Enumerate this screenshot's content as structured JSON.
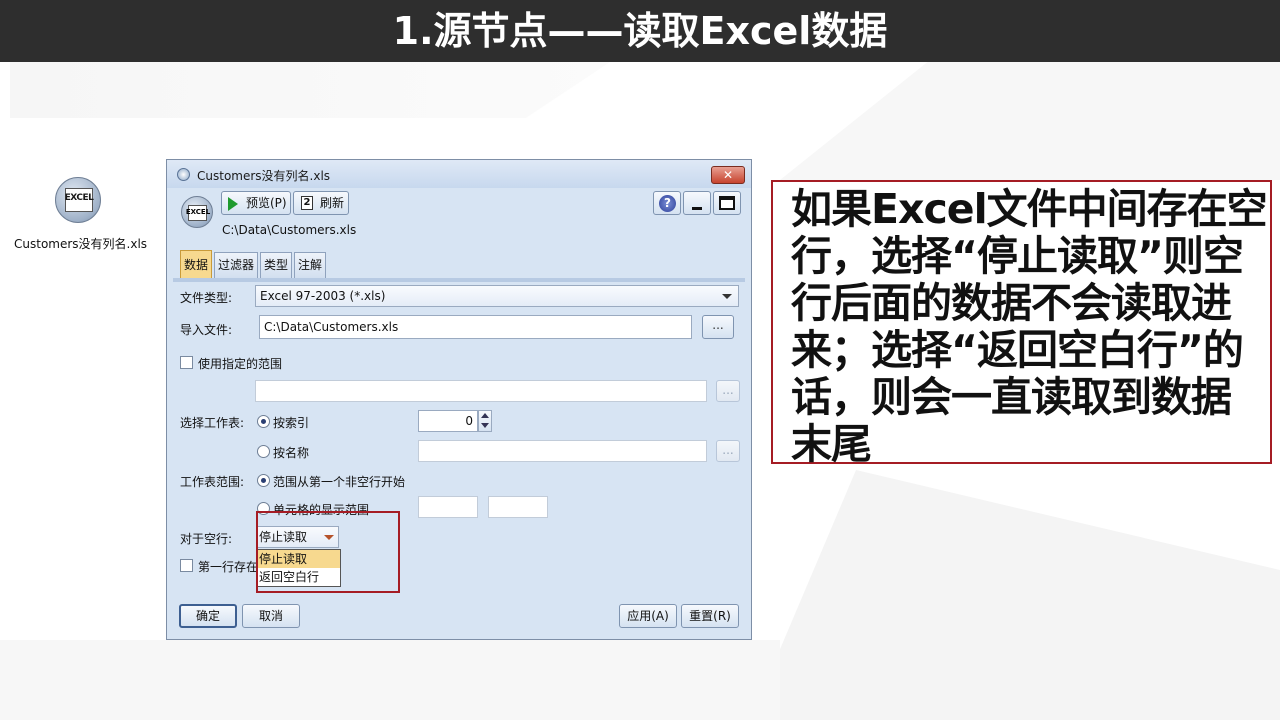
{
  "page": {
    "title": "1.源节点——读取Excel数据"
  },
  "node": {
    "icon": "excel-node-icon",
    "icon_text": "EXCEL",
    "label": "Customers没有列名.xls"
  },
  "dialog": {
    "title": "Customers没有列名.xls",
    "close_label": "✕",
    "toolbar": {
      "preview_label": "预览(P)",
      "refresh_label": "刷新",
      "refresh_icon_text": "2"
    },
    "help_label": "?",
    "file_path": "C:\\Data\\Customers.xls",
    "tabs": [
      {
        "label": "数据",
        "active": true
      },
      {
        "label": "过滤器",
        "active": false
      },
      {
        "label": "类型",
        "active": false
      },
      {
        "label": "注解",
        "active": false
      }
    ],
    "form": {
      "file_type_label": "文件类型:",
      "file_type_value": "Excel 97-2003 (*.xls)",
      "import_file_label": "导入文件:",
      "import_file_value": "C:\\Data\\Customers.xls",
      "browse_label": "...",
      "use_range_label": "使用指定的范围",
      "use_range_checked": false,
      "use_range_value": "",
      "select_sheet_label": "选择工作表:",
      "by_index_label": "按索引",
      "by_index_selected": true,
      "index_value": "0",
      "by_name_label": "按名称",
      "by_name_selected": false,
      "sheet_name_value": "",
      "sheet_range_label": "工作表范围:",
      "range_first_nonblank_label": "范围从第一个非空行开始",
      "range_first_nonblank_selected": true,
      "cell_range_label": "单元格的显示范围",
      "cell_range_selected": false,
      "cell_from": "",
      "cell_to": "",
      "blank_rows_label": "对于空行:",
      "blank_rows_value": "停止读取",
      "blank_rows_options": [
        "停止读取",
        "返回空白行"
      ],
      "first_row_label": "第一行存在",
      "first_row_checked": false
    },
    "buttons": {
      "ok": "确定",
      "cancel": "取消",
      "apply": "应用(A)",
      "reset": "重置(R)"
    }
  },
  "callout": {
    "text": "如果Excel文件中间存在空行，选择“停止读取”则空行后面的数据不会读取进来；选择“返回空白行”的话，则会一直读取到数据末尾"
  },
  "colors": {
    "title_bg": "#2e2e2e",
    "highlight": "#a51c24",
    "tab_active": "#f7d98f"
  }
}
